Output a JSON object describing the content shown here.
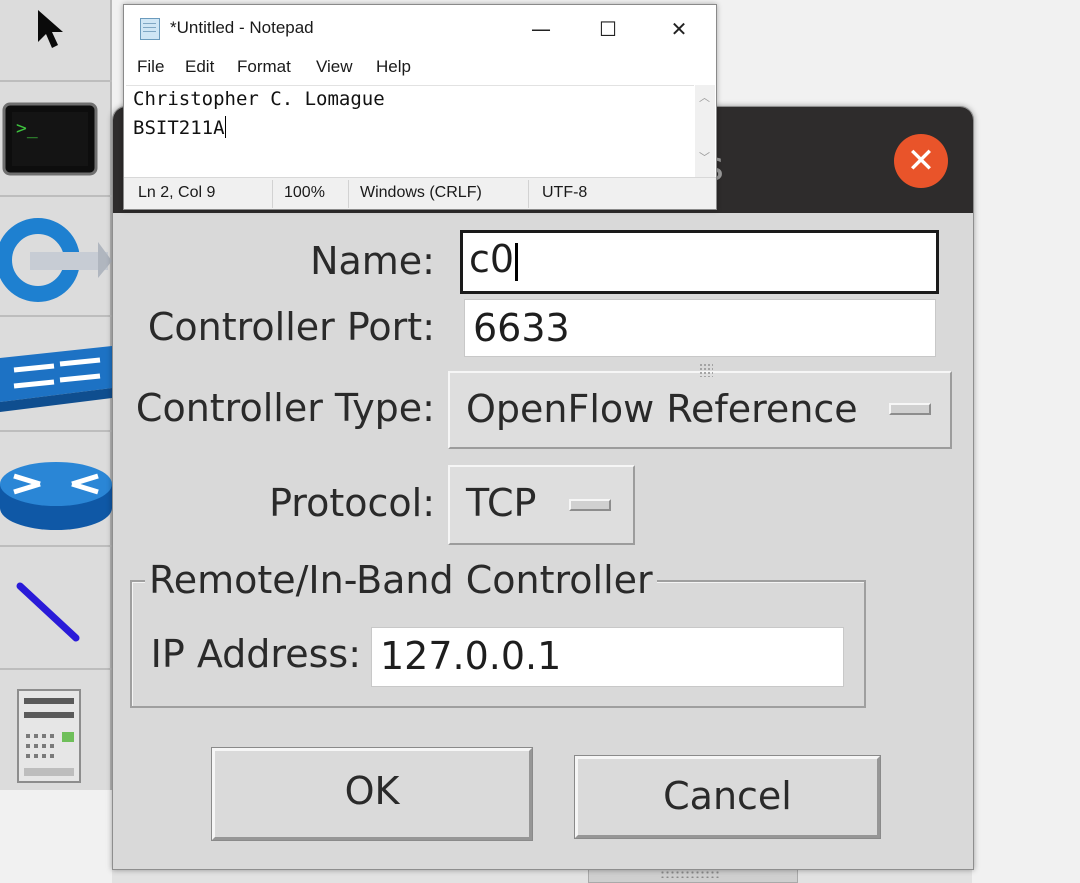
{
  "notepad": {
    "title": "*Untitled - Notepad",
    "controls": {
      "minimize": "—",
      "maximize": "☐",
      "close": "✕"
    },
    "menu": [
      "File",
      "Edit",
      "Format",
      "View",
      "Help"
    ],
    "lines": [
      "Christopher C. Lomague",
      "BSIT211A"
    ],
    "status": {
      "position": "Ln 2, Col 9",
      "zoom": "100%",
      "line_ending": "Windows (CRLF)",
      "encoding": "UTF-8"
    }
  },
  "dialog": {
    "close_glyph": "✕",
    "name_label": "Name:",
    "name_value": "c0",
    "port_label": "Controller Port:",
    "port_value": "6633",
    "type_label": "Controller Type:",
    "type_value": "OpenFlow Reference",
    "protocol_label": "Protocol:",
    "protocol_value": "TCP",
    "group_title": "Remote/In-Band Controller",
    "ip_label": "IP Address:",
    "ip_value": "127.0.0.1",
    "ok_label": "OK",
    "cancel_label": "Cancel"
  },
  "palette": {
    "tools": [
      "pointer-icon",
      "terminal-icon",
      "controller-icon",
      "switch-icon",
      "router-icon",
      "link-icon",
      "host-icon"
    ]
  },
  "colors": {
    "close_button": "#e9542a",
    "titlebar": "#2e2c2c",
    "dialog_bg": "#d9d9d9",
    "link_line": "#2a1bd8",
    "device_blue": "#1c75c8"
  }
}
